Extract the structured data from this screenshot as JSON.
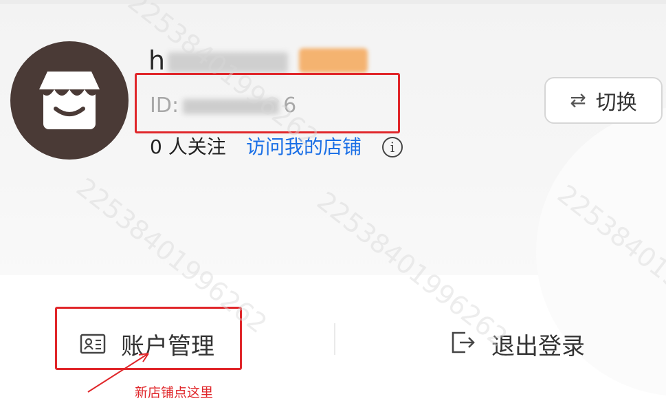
{
  "profile": {
    "username_visible": "h",
    "shop_id_prefix": "ID:",
    "shop_id_visible_tail": "6",
    "followers": "0 人关注",
    "visit_shop": "访问我的店铺",
    "info_icon": "i"
  },
  "switch_button": {
    "icon": "⇄",
    "label": "切换"
  },
  "actions": {
    "account_management": "账户管理",
    "logout": "退出登录"
  },
  "annotation": {
    "note": "新店铺点这里",
    "highlight_color": "#e0262a"
  },
  "colors": {
    "link": "#1a6fe6",
    "avatar_bg": "#4a3a36"
  },
  "watermark": {
    "number": "22538401996262"
  }
}
